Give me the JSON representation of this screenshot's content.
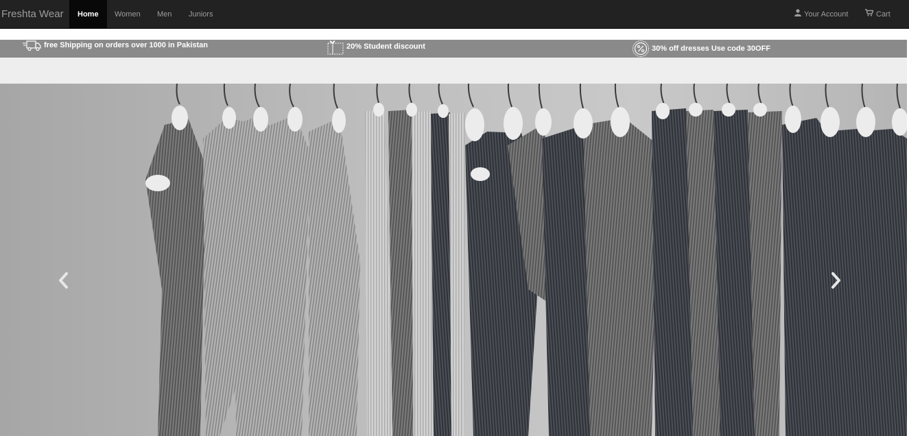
{
  "navbar": {
    "brand": "Freshta Wear",
    "items": [
      {
        "label": "Home",
        "active": true
      },
      {
        "label": "Women",
        "active": false
      },
      {
        "label": "Men",
        "active": false
      },
      {
        "label": "Juniors",
        "active": false
      }
    ],
    "account_label": "Your Account",
    "account_icon": "user-icon",
    "cart_label": "Cart",
    "cart_icon": "shopping-cart-icon"
  },
  "promos": [
    {
      "icon": "delivery-truck-icon",
      "text": "free Shipping on orders over 1000 in Pakistan"
    },
    {
      "icon": "gift-box-icon",
      "text": "20% Student discount"
    },
    {
      "icon": "percent-badge-icon",
      "text": "30% off dresses Use code 30OFF"
    }
  ],
  "carousel": {
    "prev_icon": "chevron-left-icon",
    "next_icon": "chevron-right-icon"
  },
  "colors": {
    "navbar_bg": "#222222",
    "nav_active_bg": "#080808",
    "nav_text": "#9d9d9d",
    "promo_bg": "#8a8a8a",
    "band_bg": "#eeeeee"
  }
}
